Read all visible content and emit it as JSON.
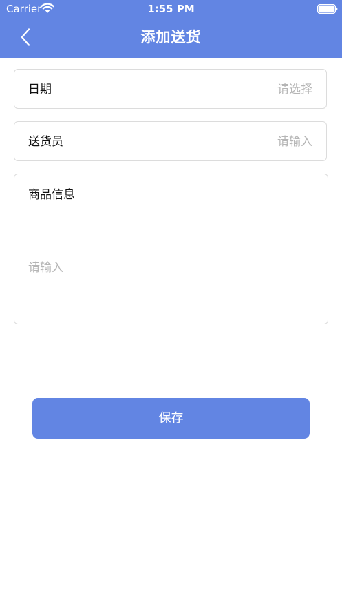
{
  "status_bar": {
    "carrier": "Carrier",
    "time": "1:55 PM"
  },
  "header": {
    "title": "添加送货"
  },
  "form": {
    "date": {
      "label": "日期",
      "placeholder": "请选择"
    },
    "courier": {
      "label": "送货员",
      "placeholder": "请输入"
    },
    "goods": {
      "label": "商品信息",
      "placeholder": "请输入"
    }
  },
  "actions": {
    "save_label": "保存"
  },
  "colors": {
    "accent": "#6285e3",
    "border": "#dcdcdc",
    "placeholder": "#b5b5b5"
  },
  "icons": {
    "back": "chevron-left-icon",
    "wifi": "wifi-icon",
    "battery": "battery-icon"
  }
}
